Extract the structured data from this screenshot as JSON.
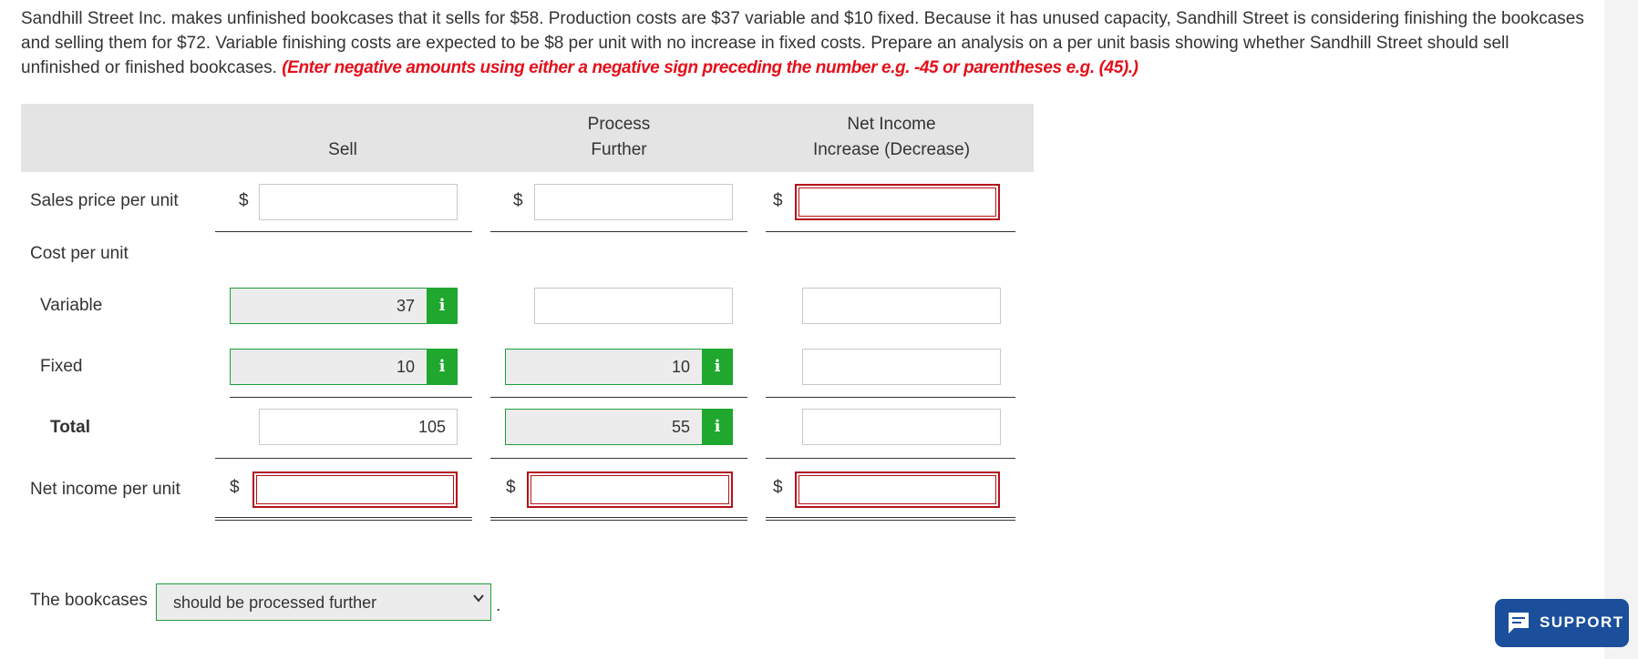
{
  "problem": {
    "text": "Sandhill Street Inc. makes unfinished bookcases that it sells for $58. Production costs are $37 variable and $10 fixed. Because it has unused capacity, Sandhill Street is considering finishing the bookcases and selling them for $72. Variable finishing costs are expected to be $8 per unit with no increase in fixed costs. Prepare an analysis on a per unit basis showing whether Sandhill Street should sell unfinished or finished bookcases.",
    "instruction": "(Enter negative amounts using either a negative sign preceding the number e.g. -45 or parentheses e.g. (45).)"
  },
  "table": {
    "headers": {
      "sell": "Sell",
      "process_further_1": "Process",
      "process_further_2": "Further",
      "net_income_1": "Net Income",
      "net_income_2": "Increase (Decrease)"
    },
    "rows": {
      "sales_price": "Sales price per unit",
      "cost_per_unit": "Cost per unit",
      "variable": "Variable",
      "fixed": "Fixed",
      "total": "Total",
      "net_income": "Net income per unit"
    },
    "currency": "$",
    "values": {
      "sell_variable": "37",
      "sell_fixed": "10",
      "sell_total": "105",
      "process_fixed": "10",
      "process_total": "55"
    },
    "info_icon": "i"
  },
  "conclusion": {
    "label": "The bookcases",
    "selected": "should be processed further",
    "period": "."
  },
  "support": {
    "label": "SUPPORT",
    "icon": "chat-icon",
    "color": "#1b4f9c"
  },
  "colors": {
    "error_border": "#b5121b",
    "given_border": "#1f9d3a",
    "info_bg": "#1fa72e",
    "instruction": "#e3101b"
  }
}
